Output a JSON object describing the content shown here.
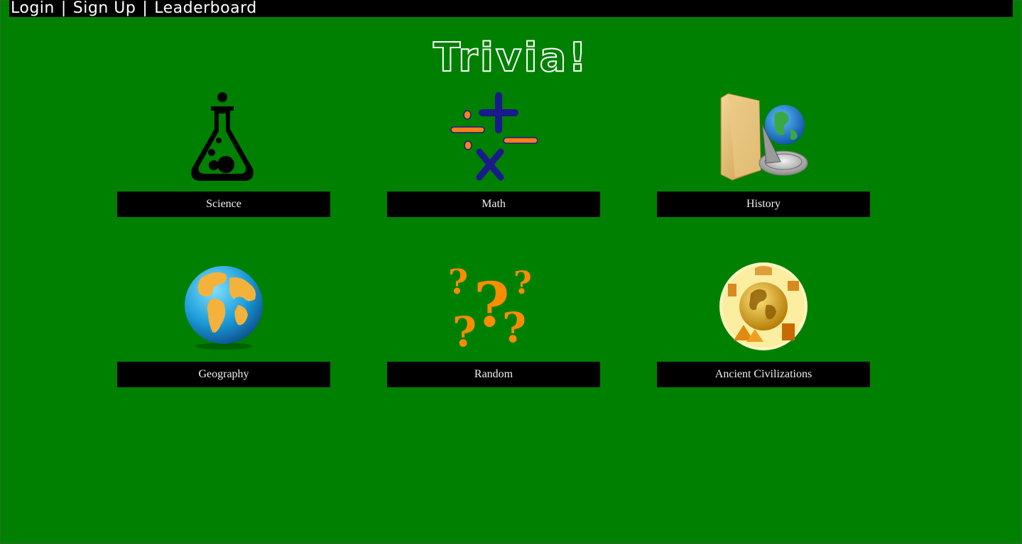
{
  "nav": {
    "login": "Login",
    "sign_up": "Sign Up",
    "leaderboard": "Leaderboard",
    "separator": "|"
  },
  "title": "Trivia!",
  "categories": [
    {
      "label": "Science",
      "icon": "flask-icon"
    },
    {
      "label": "Math",
      "icon": "math-symbols-icon"
    },
    {
      "label": "History",
      "icon": "history-folder-globe-icon"
    },
    {
      "label": "Geography",
      "icon": "globe-icon"
    },
    {
      "label": "Random",
      "icon": "question-marks-icon"
    },
    {
      "label": "Ancient Civilizations",
      "icon": "ancient-globe-icon"
    }
  ],
  "colors": {
    "background": "#008000",
    "bar": "#000000",
    "text": "#ffffff",
    "math_blue": "#1a1a8c",
    "math_orange": "#ff7f1a",
    "question_orange": "#ff8c00"
  }
}
